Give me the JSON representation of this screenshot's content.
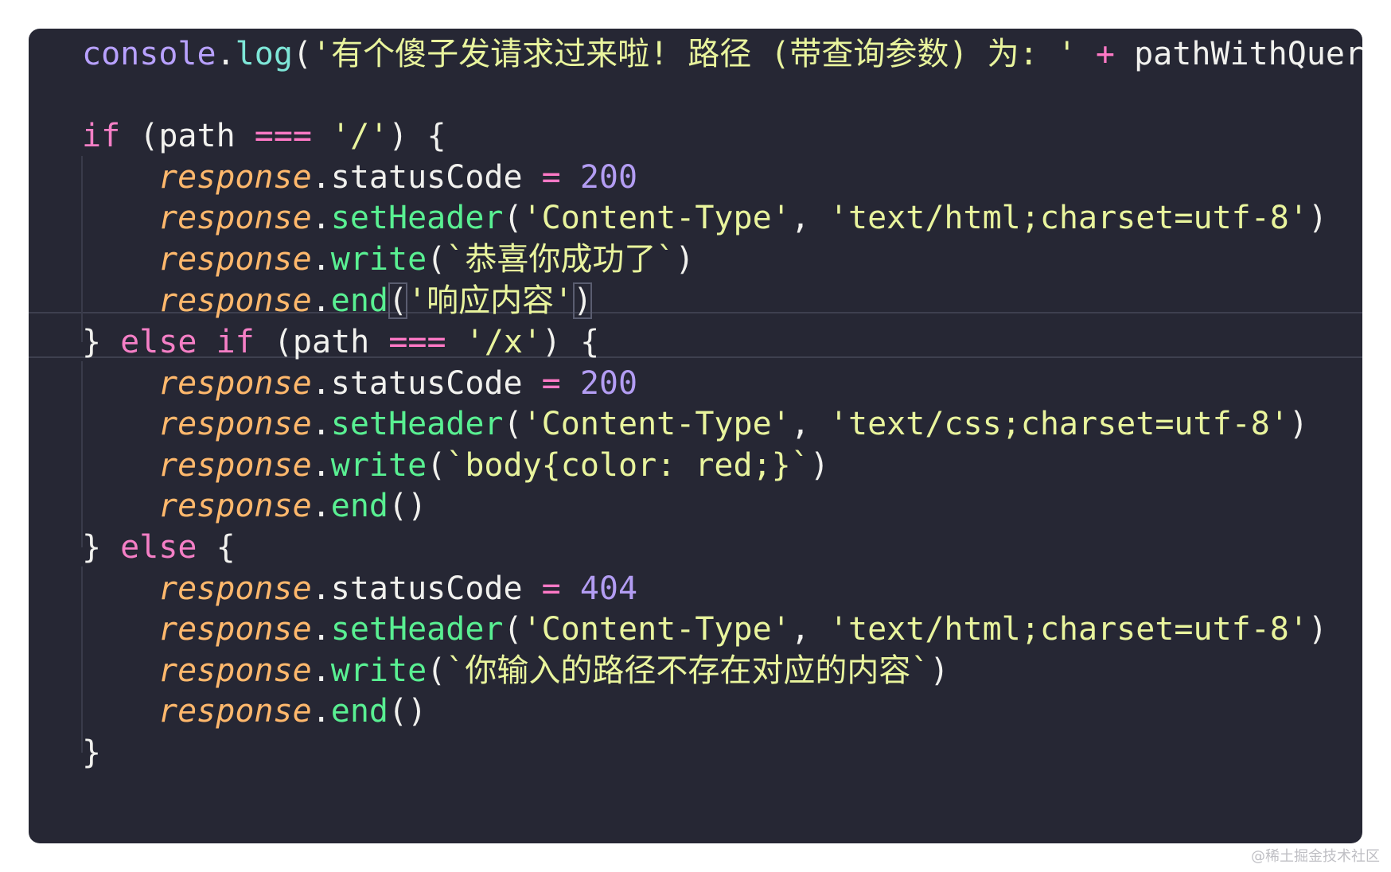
{
  "editor": {
    "theme_colors": {
      "background": "#262734",
      "keyword": "#f57fc6",
      "string": "#e9f49d",
      "number": "#b39df3",
      "method": "#59f092",
      "object": "#ffb86c",
      "plain": "#f1f1ee"
    },
    "lines": {
      "l1": {
        "obj": "console",
        "dot": ".",
        "method": "log",
        "open": "(",
        "str": "'有个傻子发请求过来啦! 路径 (带查询参数) 为: '",
        "plus": " + ",
        "var": "pathWithQuery",
        "close": ")"
      },
      "l3": {
        "kw": "if",
        "cond": " (path ",
        "op": "===",
        "str": " '/'",
        "tail": ") {"
      },
      "l4": {
        "obj": "response",
        "prop": ".statusCode ",
        "eq": "=",
        "num": " 200"
      },
      "l5": {
        "obj": "response",
        "dot": ".",
        "method": "setHeader",
        "open": "(",
        "arg1": "'Content-Type'",
        "comma": ", ",
        "arg2": "'text/html;charset=utf-8'",
        "close": ")"
      },
      "l6": {
        "obj": "response",
        "dot": ".",
        "method": "write",
        "open": "(",
        "arg": "`恭喜你成功了`",
        "close": ")"
      },
      "l7": {
        "obj": "response",
        "dot": ".",
        "method": "end",
        "open": "(",
        "arg": "'响应内容'",
        "close": ")"
      },
      "l8": {
        "brace": "} ",
        "kw": "else if",
        "cond": " (path ",
        "op": "===",
        "str": " '/x'",
        "tail": ") {"
      },
      "l9": {
        "obj": "response",
        "prop": ".statusCode ",
        "eq": "=",
        "num": " 200"
      },
      "l10": {
        "obj": "response",
        "dot": ".",
        "method": "setHeader",
        "open": "(",
        "arg1": "'Content-Type'",
        "comma": ", ",
        "arg2": "'text/css;charset=utf-8'",
        "close": ")"
      },
      "l11": {
        "obj": "response",
        "dot": ".",
        "method": "write",
        "open": "(",
        "arg": "`body{color: red;}`",
        "close": ")"
      },
      "l12": {
        "obj": "response",
        "dot": ".",
        "method": "end",
        "parens": "()"
      },
      "l13": {
        "brace": "} ",
        "kw": "else",
        "tail": " {"
      },
      "l14": {
        "obj": "response",
        "prop": ".statusCode ",
        "eq": "=",
        "num": " 404"
      },
      "l15": {
        "obj": "response",
        "dot": ".",
        "method": "setHeader",
        "open": "(",
        "arg1": "'Content-Type'",
        "comma": ", ",
        "arg2": "'text/html;charset=utf-8'",
        "close": ")"
      },
      "l16": {
        "obj": "response",
        "dot": ".",
        "method": "write",
        "open": "(",
        "arg": "`你输入的路径不存在对应的内容`",
        "close": ")"
      },
      "l17": {
        "obj": "response",
        "dot": ".",
        "method": "end",
        "parens": "()"
      },
      "l18": {
        "brace": "}"
      }
    }
  },
  "watermark": "@稀土掘金技术社区"
}
